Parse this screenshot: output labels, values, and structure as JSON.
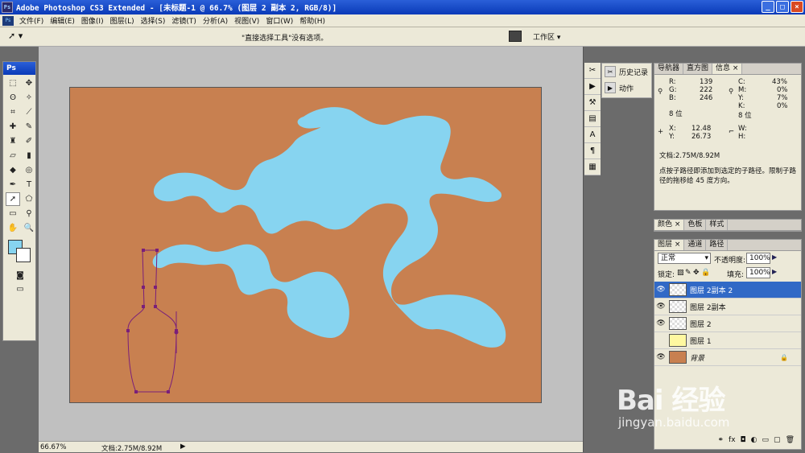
{
  "window": {
    "title": "Adobe Photoshop CS3 Extended - [未标题-1 @ 66.7% (图层 2 副本 2, RGB/8)]",
    "app_icon": "Ps",
    "controls": [
      "_",
      "□",
      "×"
    ]
  },
  "menu": [
    "文件(F)",
    "编辑(E)",
    "图像(I)",
    "图层(L)",
    "选择(S)",
    "滤镜(T)",
    "分析(A)",
    "视图(V)",
    "窗口(W)",
    "帮助(H)"
  ],
  "options_bar": {
    "message": "\"直接选择工具\"没有选项。",
    "workspace_label": "工作区 ▾"
  },
  "toolbox": {
    "header": "Ps",
    "tools": [
      "marquee-icon",
      "move-icon",
      "lasso-icon",
      "magic-wand-icon",
      "crop-icon",
      "slice-icon",
      "healing-brush-icon",
      "brush-icon",
      "clone-stamp-icon",
      "history-brush-icon",
      "eraser-icon",
      "gradient-icon",
      "blur-icon",
      "dodge-icon",
      "pen-icon",
      "type-icon",
      "direct-selection-icon",
      "shape-icon",
      "notes-icon",
      "eyedropper-icon",
      "hand-icon",
      "zoom-icon"
    ],
    "foreground_color": "#87d4f0",
    "background_color": "#ffffff"
  },
  "status": {
    "zoom": "66.67%",
    "doc_size": "文档:2.75M/8.92M"
  },
  "dock": {
    "history_label": "历史记录",
    "actions_label": "动作"
  },
  "info_panel": {
    "tabs": [
      "导航器",
      "直方图",
      "信息 ×"
    ],
    "R": "139",
    "G": "222",
    "B": "246",
    "C": "43%",
    "M": "0%",
    "Y_cmyk": "7%",
    "K": "0%",
    "bits_left": "8 位",
    "bits_right": "8 位",
    "X": "12.48",
    "Y": "26.73",
    "W": "",
    "H": "",
    "doc": "文档:2.75M/8.92M",
    "hint": "点按子路径即添加到选定的子路径。限制子路径的拖移给 45 度方向。"
  },
  "color_panel": {
    "tabs": [
      "颜色 ×",
      "色板",
      "样式"
    ]
  },
  "layers_panel": {
    "tabs": [
      "图层 ×",
      "通道",
      "路径"
    ],
    "blend_mode": "正常",
    "opacity_label": "不透明度:",
    "opacity": "100%",
    "lock_label": "锁定:",
    "fill_label": "填充:",
    "fill": "100%",
    "layers": [
      {
        "name": "图层 2副本 2",
        "visible": true,
        "selected": true
      },
      {
        "name": "图层 2副本",
        "visible": true,
        "selected": false
      },
      {
        "name": "图层 2",
        "visible": true,
        "selected": false
      },
      {
        "name": "图层 1",
        "visible": false,
        "selected": false
      },
      {
        "name": "背景",
        "visible": true,
        "selected": false,
        "locked": true
      }
    ]
  },
  "watermark": {
    "brand": "Bai 经验",
    "url": "jingyan.baidu.com"
  }
}
